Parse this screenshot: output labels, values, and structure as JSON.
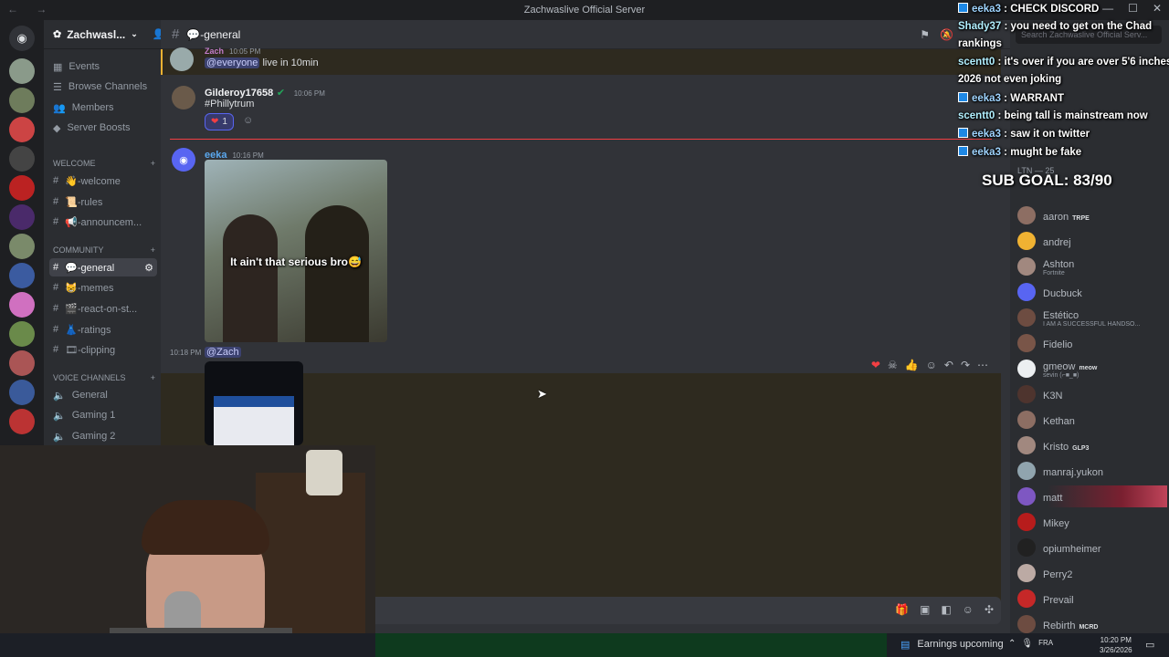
{
  "window": {
    "title": "Zachwaslive Official Server",
    "nav_arrows": "← →",
    "controls": [
      "—",
      "☐",
      "✕"
    ]
  },
  "server": {
    "name": "Zachwasl...",
    "nav": [
      "Events",
      "Browse Channels",
      "Members",
      "Server Boosts"
    ]
  },
  "categories": {
    "welcome": "WELCOME",
    "community": "COMMUNITY",
    "voice": "VOICE CHANNELS"
  },
  "channels": {
    "welcome": [
      "👋-welcome",
      "📜-rules",
      "📢-announcem..."
    ],
    "community": [
      "💬-general",
      "😸-memes",
      "🎬-react-on-st...",
      "👗-ratings",
      "🎞-clipping"
    ],
    "voice": [
      "General",
      "Gaming 1",
      "Gaming 2"
    ]
  },
  "header": {
    "channel": "💬-general",
    "search_placeholder": "Search Zachwaslive Official Serv..."
  },
  "messages": {
    "m1": {
      "author": "Zach",
      "time": "10:05 PM",
      "mention": "@everyone",
      "text": "live in 10min"
    },
    "m2": {
      "author": "Gilderoy17658",
      "time": "10:06 PM",
      "text": "#Phillytrum",
      "reaction_count": "1"
    },
    "m3": {
      "author": "eeka",
      "time": "10:16 PM",
      "caption": "It ain't that serious bro😅"
    },
    "m4": {
      "time": "10:18 PM",
      "mention": "@Zach"
    }
  },
  "members": [
    {
      "name": "aaron",
      "tag": "TRPE",
      "color": "#8d6e63"
    },
    {
      "name": "andrej",
      "color": "#f0b232"
    },
    {
      "name": "Ashton",
      "sub": "Fortnite",
      "color": "#a1887f"
    },
    {
      "name": "Ducbuck",
      "color": "#5865f2"
    },
    {
      "name": "Estético",
      "sub": "I AM A SUCCESSFUL HANDSO...",
      "color": "#6d4c41"
    },
    {
      "name": "Fidelio",
      "color": "#795548"
    },
    {
      "name": "gmeow",
      "tag": "meow",
      "sub": "sevin (⌐■_■)",
      "color": "#eceff1"
    },
    {
      "name": "K3N",
      "color": "#4e342e"
    },
    {
      "name": "Kethan",
      "color": "#8d6e63"
    },
    {
      "name": "Kristo",
      "tag": "GLP3",
      "color": "#a1887f"
    },
    {
      "name": "manraj.yukon",
      "color": "#90a4ae"
    },
    {
      "name": "matt",
      "color": "#7e57c2"
    },
    {
      "name": "Mikey",
      "color": "#b71c1c"
    },
    {
      "name": "opiumheimer",
      "color": "#212121"
    },
    {
      "name": "Perry2",
      "color": "#bcaaa4"
    },
    {
      "name": "Prevail",
      "color": "#c62828"
    },
    {
      "name": "Rebirth",
      "tag": "MCRD",
      "color": "#6d4c41"
    }
  ],
  "members_header": "LTN — 25",
  "chat_overlay": [
    {
      "user": "eeka3",
      "text": "CHECK DISCORD",
      "icon": true
    },
    {
      "user": "Shady37",
      "text": "you need to get on the Chad",
      "icon": false
    },
    {
      "user": "",
      "text": "rankings",
      "icon": false
    },
    {
      "user": "scentt0",
      "text": "it's over if you are over 5'6 inches",
      "icon": false
    },
    {
      "user": "",
      "text": "2026 not even joking",
      "icon": false
    },
    {
      "user": "eeka3",
      "text": "WARRANT",
      "icon": true
    },
    {
      "user": "scentt0",
      "text": "being tall is mainstream now",
      "icon": false
    },
    {
      "user": "eeka3",
      "text": "saw it on twitter",
      "icon": true
    },
    {
      "user": "eeka3",
      "text": "mught be fake",
      "icon": true
    }
  ],
  "sub_goal": "SUB GOAL: 83/90",
  "taskbar": {
    "news": "Earnings upcoming",
    "lang": "FRA",
    "time": "10:20 PM",
    "date": "3/26/2026"
  },
  "colors": {
    "accent": "#5865f2",
    "online": "#23a55a",
    "mention_bg": "#3c4270"
  }
}
